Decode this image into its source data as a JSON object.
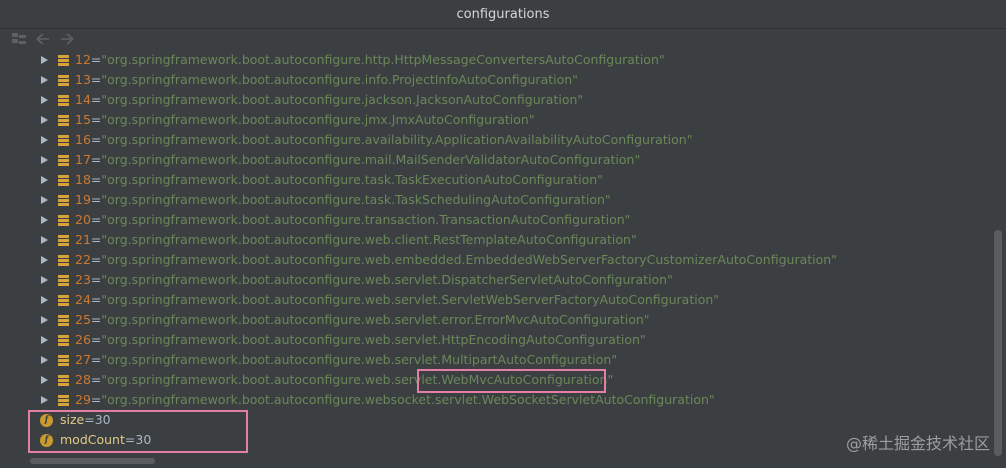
{
  "window": {
    "title": "configurations"
  },
  "toolbar": {
    "buttons": [
      {
        "icon": "group-icon"
      },
      {
        "icon": "back-arrow-icon"
      },
      {
        "icon": "forward-arrow-icon"
      }
    ]
  },
  "items": [
    {
      "index": "12",
      "value": "\"org.springframework.boot.autoconfigure.http.HttpMessageConvertersAutoConfiguration\""
    },
    {
      "index": "13",
      "value": "\"org.springframework.boot.autoconfigure.info.ProjectInfoAutoConfiguration\""
    },
    {
      "index": "14",
      "value": "\"org.springframework.boot.autoconfigure.jackson.JacksonAutoConfiguration\""
    },
    {
      "index": "15",
      "value": "\"org.springframework.boot.autoconfigure.jmx.JmxAutoConfiguration\""
    },
    {
      "index": "16",
      "value": "\"org.springframework.boot.autoconfigure.availability.ApplicationAvailabilityAutoConfiguration\""
    },
    {
      "index": "17",
      "value": "\"org.springframework.boot.autoconfigure.mail.MailSenderValidatorAutoConfiguration\""
    },
    {
      "index": "18",
      "value": "\"org.springframework.boot.autoconfigure.task.TaskExecutionAutoConfiguration\""
    },
    {
      "index": "19",
      "value": "\"org.springframework.boot.autoconfigure.task.TaskSchedulingAutoConfiguration\""
    },
    {
      "index": "20",
      "value": "\"org.springframework.boot.autoconfigure.transaction.TransactionAutoConfiguration\""
    },
    {
      "index": "21",
      "value": "\"org.springframework.boot.autoconfigure.web.client.RestTemplateAutoConfiguration\""
    },
    {
      "index": "22",
      "value": "\"org.springframework.boot.autoconfigure.web.embedded.EmbeddedWebServerFactoryCustomizerAutoConfiguration\""
    },
    {
      "index": "23",
      "value": "\"org.springframework.boot.autoconfigure.web.servlet.DispatcherServletAutoConfiguration\""
    },
    {
      "index": "24",
      "value": "\"org.springframework.boot.autoconfigure.web.servlet.ServletWebServerFactoryAutoConfiguration\""
    },
    {
      "index": "25",
      "value": "\"org.springframework.boot.autoconfigure.web.servlet.error.ErrorMvcAutoConfiguration\""
    },
    {
      "index": "26",
      "value": "\"org.springframework.boot.autoconfigure.web.servlet.HttpEncodingAutoConfiguration\""
    },
    {
      "index": "27",
      "value": "\"org.springframework.boot.autoconfigure.web.servlet.MultipartAutoConfiguration\""
    },
    {
      "index": "28",
      "value": "\"org.springframework.boot.autoconfigure.web.servlet.WebMvcAutoConfiguration\""
    },
    {
      "index": "29",
      "value": "\"org.springframework.boot.autoconfigure.websocket.servlet.WebSocketServletAutoConfiguration\""
    }
  ],
  "fields": [
    {
      "icon_letter": "f",
      "name": "size",
      "value": "30"
    },
    {
      "icon_letter": "f",
      "name": "modCount",
      "value": "30"
    }
  ],
  "equals": "=",
  "watermark": "@稀土掘金技术社区",
  "colors": {
    "background": "#3c3f41",
    "index": "#cc7832",
    "string": "#6a8759",
    "field_icon": "#c99a2e",
    "highlight": "#e27fa3"
  }
}
